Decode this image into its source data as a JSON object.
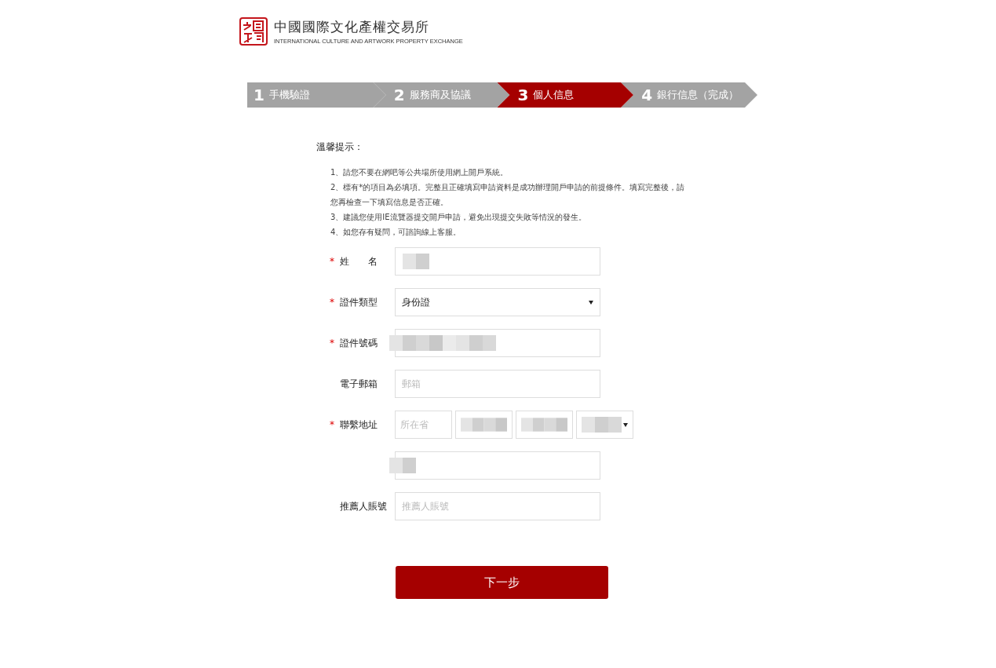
{
  "logo": {
    "title": "中國國際文化產權交易所",
    "subtitle": "INTERNATIONAL CULTURE AND ARTWORK PROPERTY EXCHANGE"
  },
  "steps": [
    {
      "number": "1",
      "label": "手機驗證",
      "selected": false
    },
    {
      "number": "2",
      "label": "服務商及協議",
      "selected": false
    },
    {
      "number": "3",
      "label": "個人信息",
      "selected": true
    },
    {
      "number": "4",
      "label": "銀行信息（完成）",
      "selected": false
    }
  ],
  "notice": {
    "title": "溫馨提示：",
    "items": [
      "1、請您不要在網吧等公共場所使用網上開戶系統。",
      "2、標有*的項目為必填項。完整且正確填寫申請資料是成功辦理開戶申請的前提條件。填寫完整後，請您再檢查一下填寫信息是否正確。",
      "3、建議您使用IE流覽器提交開戶申請，避免出現提交失敗等情況的發生。",
      "4、如您存有疑問，可諮詢線上客服。"
    ]
  },
  "form": [
    {
      "kind": "text",
      "label": "姓　　名",
      "required_mark": "*",
      "redacted": true
    },
    {
      "kind": "select",
      "label": "證件類型",
      "required_mark": "*",
      "value": "身份證"
    },
    {
      "kind": "text",
      "label": "證件號碼",
      "required_mark": "*",
      "redacted": true
    },
    {
      "kind": "text",
      "label": "電子郵箱",
      "placeholder": "郵箱"
    },
    {
      "kind": "address",
      "label": "聯繫地址",
      "required_mark": "*",
      "placeholder": "所在省",
      "redacted": true
    },
    {
      "kind": "text",
      "redacted": true
    },
    {
      "kind": "text",
      "label": "推薦人賬號",
      "placeholder": "推薦人賬號"
    }
  ],
  "next_button": "下一步"
}
